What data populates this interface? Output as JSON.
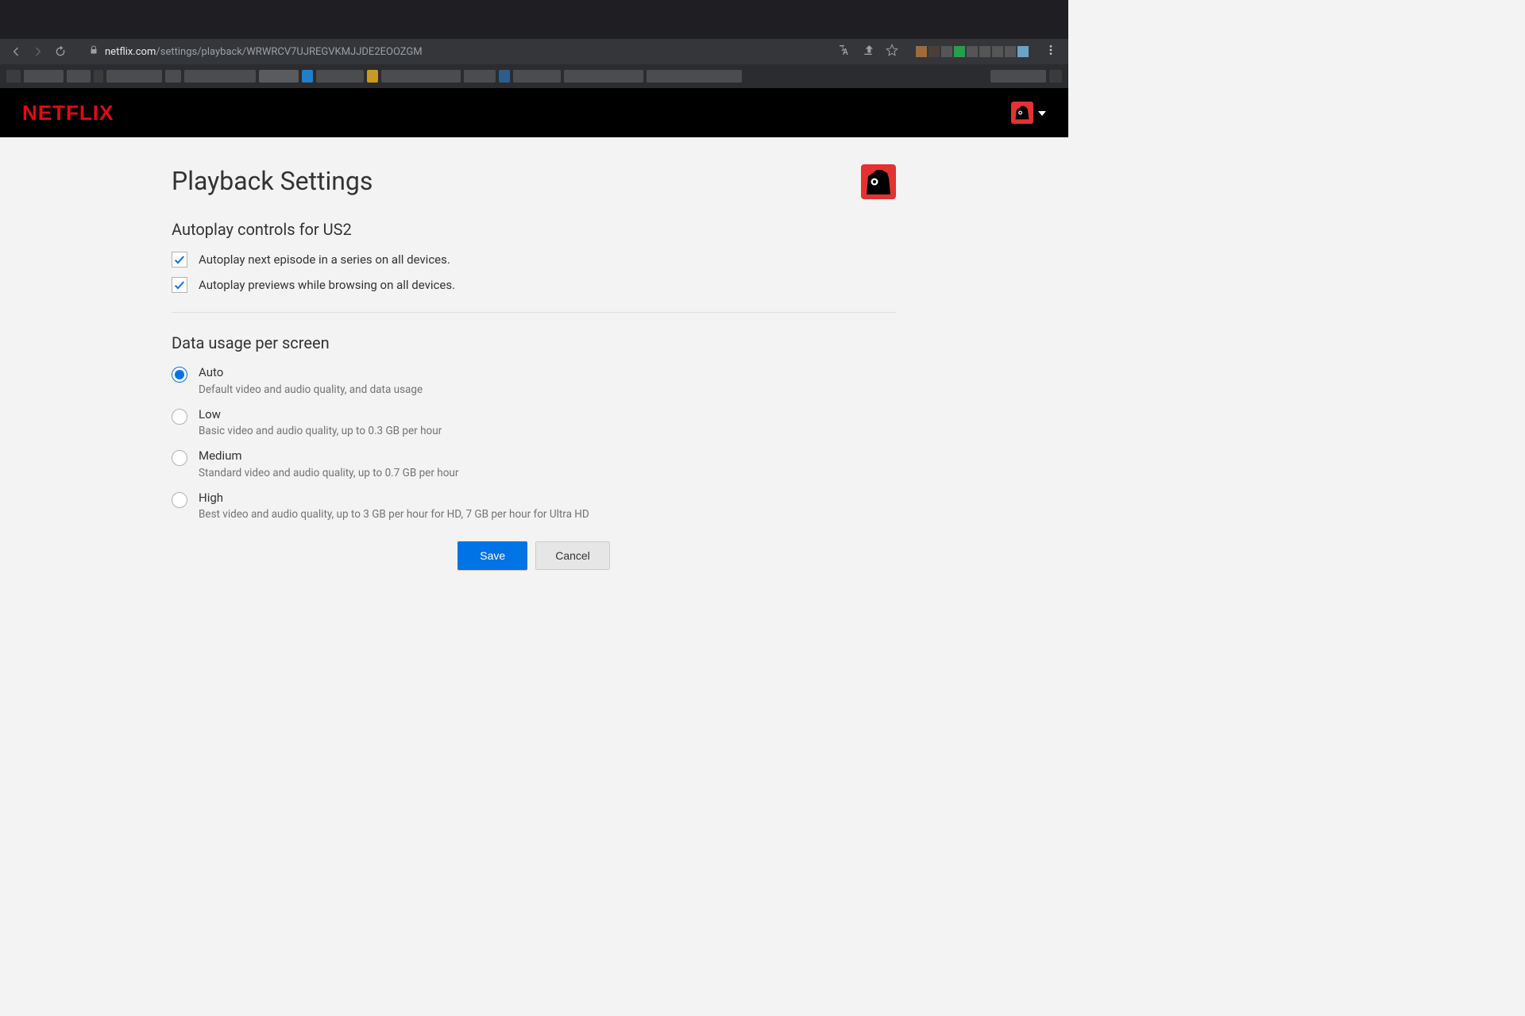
{
  "browser": {
    "url_domain": "netflix.com",
    "url_path": "/settings/playback/WRWRCV7UJREGVKMJJDE2EOOZGM"
  },
  "header": {
    "brand": "NETFLIX"
  },
  "page": {
    "title": "Playback Settings"
  },
  "autoplay": {
    "section_title": "Autoplay controls for US2",
    "options": [
      {
        "label": "Autoplay next episode in a series on all devices.",
        "checked": true
      },
      {
        "label": "Autoplay previews while browsing on all devices.",
        "checked": true
      }
    ]
  },
  "data_usage": {
    "section_title": "Data usage per screen",
    "selected_index": 0,
    "options": [
      {
        "label": "Auto",
        "desc": "Default video and audio quality, and data usage"
      },
      {
        "label": "Low",
        "desc": "Basic video and audio quality, up to 0.3 GB per hour"
      },
      {
        "label": "Medium",
        "desc": "Standard video and audio quality, up to 0.7 GB per hour"
      },
      {
        "label": "High",
        "desc": "Best video and audio quality, up to 3 GB per hour for HD, 7 GB per hour for Ultra HD"
      }
    ]
  },
  "buttons": {
    "save": "Save",
    "cancel": "Cancel"
  }
}
